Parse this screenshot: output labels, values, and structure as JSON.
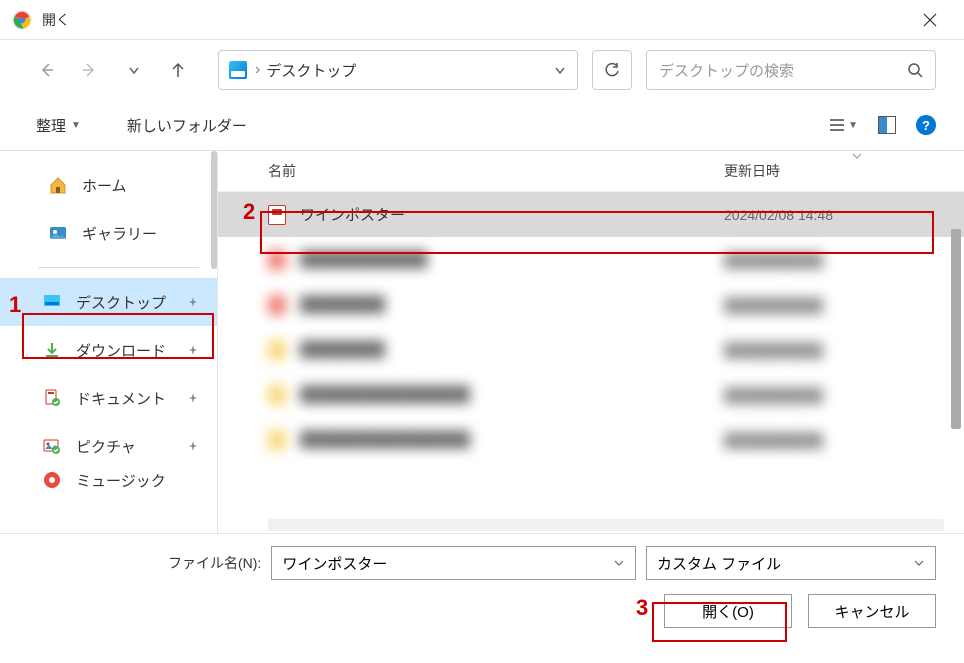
{
  "title": "開く",
  "path": {
    "location": "デスクトップ"
  },
  "search": {
    "placeholder": "デスクトップの検索"
  },
  "toolbar": {
    "organize": "整理",
    "new_folder": "新しいフォルダー"
  },
  "sidebar": {
    "home": "ホーム",
    "gallery": "ギャラリー",
    "desktop": "デスクトップ",
    "downloads": "ダウンロード",
    "documents": "ドキュメント",
    "pictures": "ピクチャ",
    "music": "ミュージック"
  },
  "list_header": {
    "name": "名前",
    "date": "更新日時"
  },
  "files": {
    "selected": {
      "name": "ワインポスター",
      "date": "2024/02/08 14:48"
    }
  },
  "bottom": {
    "fname_label": "ファイル名(N):",
    "fname_value": "ワインポスター",
    "filter": "カスタム ファイル",
    "open": "開く(O)",
    "cancel": "キャンセル"
  },
  "annotations": {
    "a1": "1",
    "a2": "2",
    "a3": "3"
  }
}
